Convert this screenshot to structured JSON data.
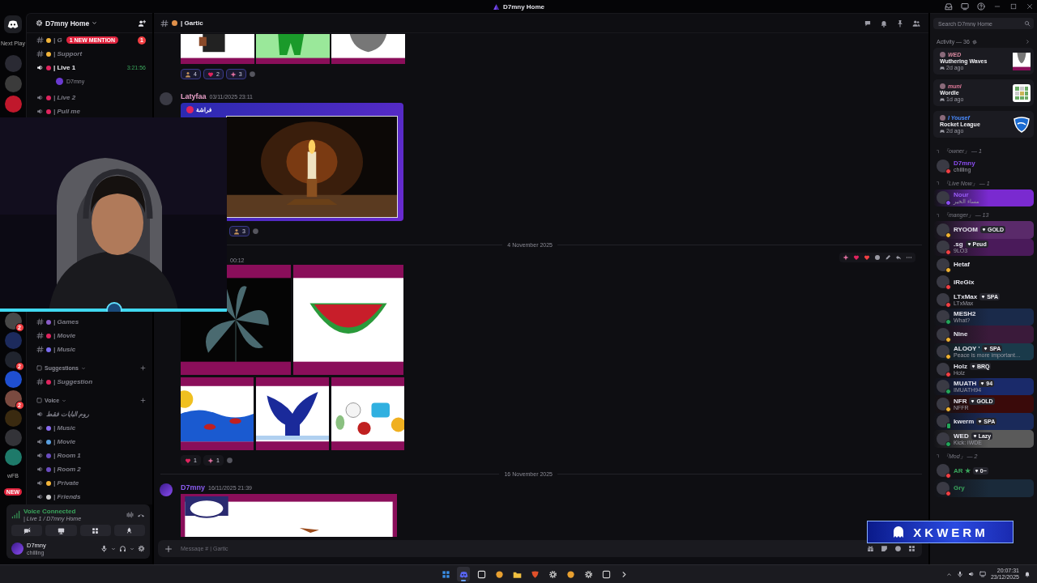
{
  "window": {
    "title": "D7mny Home"
  },
  "servers": {
    "top": [
      {
        "kind": "logo"
      },
      {
        "kind": "label",
        "label": "Next Play"
      },
      {
        "kind": "avatar",
        "color": "#2a2a33"
      },
      {
        "kind": "avatar",
        "color": "#3b3b3b"
      },
      {
        "kind": "avatar",
        "color": "#c0182c"
      }
    ],
    "bottom": [
      {
        "kind": "avatar",
        "color": "#474747",
        "badge": "2"
      },
      {
        "kind": "avatar",
        "color": "#1c2a5c"
      },
      {
        "kind": "avatar",
        "color": "#20242e",
        "badge": "2"
      },
      {
        "kind": "avatar",
        "color": "#1f4fd0"
      },
      {
        "kind": "avatar",
        "color": "#7a4a40",
        "badge": "2"
      },
      {
        "kind": "avatar",
        "color": "#3a2a10"
      },
      {
        "kind": "avatar",
        "color": "#333338"
      },
      {
        "kind": "avatar",
        "color": "#1e7a6a"
      },
      {
        "kind": "label",
        "label": "wFB"
      },
      {
        "kind": "pill",
        "label": "NEW"
      }
    ]
  },
  "channels": {
    "server_name": "D7mny Home",
    "top": [
      {
        "kind": "text",
        "color": "#f2b43a",
        "name": "| G",
        "mention": "1 NEW MENTION",
        "badge": "1",
        "active": false
      },
      {
        "kind": "text",
        "color": "#f2b43a",
        "name": "| Support",
        "active": false
      },
      {
        "kind": "voice",
        "color": "#e0245e",
        "name": "| Live 1",
        "active": true,
        "timer": "3:21:56",
        "members": [
          {
            "name": "D7mny"
          }
        ]
      },
      {
        "kind": "voice",
        "color": "#e0245e",
        "name": "| Live 2",
        "active": false
      },
      {
        "kind": "voice",
        "color": "#e0245e",
        "name": "| Pull me",
        "active": false
      }
    ],
    "bottom": [
      {
        "kind": "text",
        "color": "#8a5cc8",
        "name": "| Games",
        "active": false
      },
      {
        "kind": "text",
        "color": "#e0245e",
        "name": "| Movie",
        "active": false
      },
      {
        "kind": "text",
        "color": "#7a6cf0",
        "name": "| Music",
        "active": false
      },
      {
        "kind": "category",
        "name": "Suggestions"
      },
      {
        "kind": "text",
        "color": "#e0245e",
        "name": "| Suggestion",
        "active": false
      },
      {
        "kind": "category",
        "name": "Voice"
      },
      {
        "kind": "voice",
        "name": "روم البايات فقط",
        "active": false
      },
      {
        "kind": "voice",
        "color": "#8a6cf0",
        "name": "| Music",
        "active": false
      },
      {
        "kind": "voice",
        "color": "#5aa0e0",
        "name": "| Movie",
        "active": false
      },
      {
        "kind": "voice",
        "color": "#6a4cc0",
        "name": "| Room 1",
        "active": false
      },
      {
        "kind": "voice",
        "color": "#6a4cc0",
        "name": "| Room 2",
        "active": false
      },
      {
        "kind": "voice",
        "color": "#f2b43a",
        "name": "| Private",
        "active": false
      },
      {
        "kind": "voice",
        "color": "#cccccc",
        "name": "| Friends",
        "active": false
      }
    ]
  },
  "voice_panel": {
    "status": "Voice Connected",
    "location": "| Live 1 / D7mny Home"
  },
  "user": {
    "name": "D7mny",
    "status_text": "chilling"
  },
  "chat": {
    "channel": "| Gartic",
    "messages": [
      {
        "kind": "image_row",
        "images": [
          {
            "kind": "picture"
          },
          {
            "kind": "picture"
          },
          {
            "kind": "picture"
          }
        ],
        "reactions": [
          {
            "count": "4"
          },
          {
            "count": "2"
          },
          {
            "count": "3"
          }
        ]
      },
      {
        "kind": "embed",
        "author": "Latyfaa",
        "color": "#e8a0c8",
        "time": "03/11/2025 23:11",
        "embed_title": "فراشة",
        "reactions": [
          {
            "count": "3"
          }
        ]
      },
      {
        "kind": "divider",
        "date": "4 November 2025"
      },
      {
        "kind": "gallery",
        "time": "00:12",
        "hovered": true,
        "images": [
          {
            "kind": "picture"
          },
          {
            "kind": "picture"
          },
          {
            "kind": "picture"
          },
          {
            "kind": "picture"
          },
          {
            "kind": "picture"
          }
        ],
        "reactions": [
          {
            "count": "1"
          },
          {
            "count": "1"
          }
        ]
      },
      {
        "kind": "divider",
        "date": "16 November 2025"
      },
      {
        "author": "D7mny",
        "color": "#8a5cf0",
        "time": "16/11/2025 21:39"
      }
    ],
    "composer": {
      "placeholder": "Message # | Gartic"
    }
  },
  "members": {
    "search_placeholder": "Search D7mny Home",
    "activity": {
      "title": "Activity — 36",
      "cards": [
        {
          "kind": "portrait",
          "user": "WED",
          "game": "Wuthering Waves",
          "ago": "2d ago",
          "color": "#d98aa0"
        },
        {
          "kind": "grid",
          "user": "muni",
          "game": "Wordle",
          "ago": "1d ago",
          "color": "#e07a9a"
        },
        {
          "kind": "shield",
          "user": "I Yousef",
          "game": "Rocket League",
          "ago": "2d ago",
          "color": "#4a8cff"
        }
      ]
    },
    "groups": [
      {
        "title": "『owner』 — 1",
        "color": "#8a4cf0",
        "members": [
          {
            "name": "D7mny",
            "kind": "dnd",
            "activity": "chilling"
          }
        ]
      },
      {
        "title": "『Live Now』 — 1",
        "color": "#9a5cf8",
        "members": [
          {
            "name": "Nour",
            "kind": "streaming",
            "activity": "مساء الخير",
            "color": "#7a2ad0"
          }
        ]
      },
      {
        "title": "『manger』 — 13",
        "color": "#e4e4ec",
        "members": [
          {
            "name": "RYOOM",
            "tag": "GOLD",
            "kind": "idle",
            "color": "#5a2a6a"
          },
          {
            "name": ".sg",
            "tag": "Peud",
            "kind": "dnd",
            "activity": "9LO3",
            "color": "#4a1a5a"
          },
          {
            "name": "Hetaf",
            "kind": "idle"
          },
          {
            "name": "iReGix",
            "kind": "dnd"
          },
          {
            "name": "LTxMax",
            "tag": "SPA",
            "kind": "dnd",
            "activity": "LTxMax"
          },
          {
            "name": "MESH2",
            "kind": "online",
            "activity": "What?",
            "color": "#1a2a4a"
          },
          {
            "name": "Nine",
            "kind": "idle",
            "color": "#3a1a3a"
          },
          {
            "name": "ALOOY '",
            "tag": "SPA",
            "kind": "idle",
            "activity": "Peace is more important…",
            "color": "#1a3a4a"
          },
          {
            "name": "Holz",
            "tag": "BRQ",
            "kind": "dnd",
            "activity": "Holz"
          },
          {
            "name": "MUATH",
            "tag": "94",
            "kind": "online",
            "activity": "IMUATH94",
            "color": "#1a2a6a"
          },
          {
            "name": "NFR",
            "tag": "GOLD",
            "kind": "idle",
            "activity": "NFFR",
            "color": "#3a0a0a"
          },
          {
            "name": "kwerm",
            "tag": "SPA",
            "kind": "mobile",
            "color": "#1a2a5a"
          },
          {
            "name": "WED",
            "tag": "Lazy",
            "kind": "online",
            "activity": "Kick: iWDE",
            "color": "#5a5a5a"
          }
        ]
      },
      {
        "title": "『Mod』 — 2",
        "color": "#3aa55c",
        "members": [
          {
            "name": "AR ★",
            "tag": "0~",
            "kind": "dnd"
          },
          {
            "name": "Gry",
            "kind": "dnd",
            "color": "#1a2a3a"
          }
        ]
      }
    ]
  },
  "overlay_label": "XKWERM",
  "taskbar": {
    "time": "20:07:31",
    "date": "23/12/2025",
    "apps": [
      {
        "kind": "start",
        "selected": false
      },
      {
        "kind": "chat",
        "selected": true
      },
      {
        "kind": "windows",
        "selected": false
      },
      {
        "kind": "browser",
        "selected": false
      },
      {
        "kind": "folder",
        "selected": false
      },
      {
        "kind": "shield",
        "selected": false
      },
      {
        "kind": "gear",
        "selected": false
      },
      {
        "kind": "browser",
        "selected": false
      },
      {
        "kind": "gear",
        "selected": false
      },
      {
        "kind": "app",
        "selected": false
      },
      {
        "kind": "arrows",
        "selected": false
      }
    ]
  }
}
